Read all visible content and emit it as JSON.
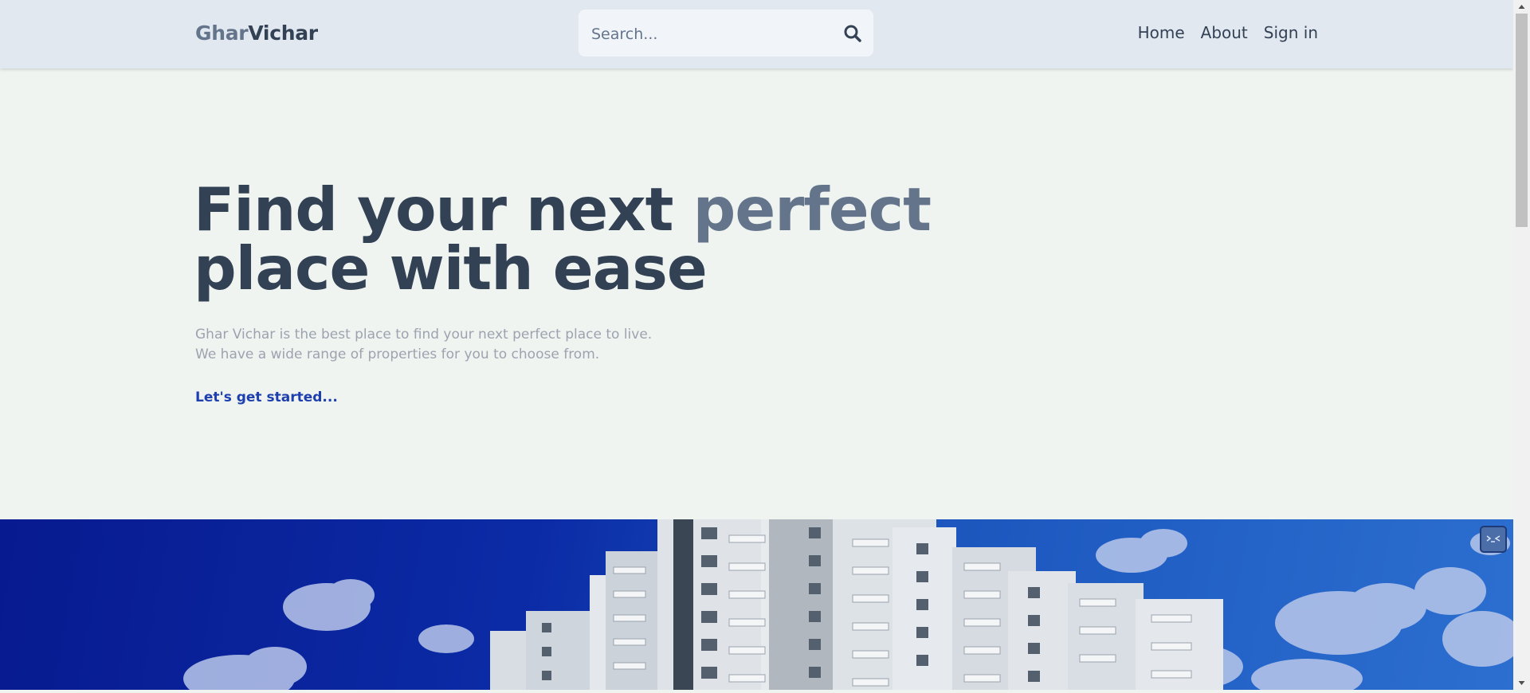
{
  "header": {
    "logo_part1": "Ghar",
    "logo_part2": "Vichar",
    "search_placeholder": "Search...",
    "nav": [
      "Home",
      "About",
      "Sign in"
    ]
  },
  "hero": {
    "title_part1": "Find your next ",
    "title_accent": "perfect",
    "title_line2": "place with ease",
    "subtitle_line1": "Ghar Vichar is the best place to find your next perfect place to live.",
    "subtitle_line2": "We have a wide range of properties for you to choose from.",
    "cta": "Let's get started..."
  },
  "banner": {
    "image": "apartment-buildings-blue-sky-photo"
  },
  "colors": {
    "header_bg": "#e2e8f0",
    "page_bg": "#f0f4f1",
    "title": "#334155",
    "title_accent": "#64748b",
    "subtitle": "#9ca3af",
    "cta": "#1e40af"
  }
}
